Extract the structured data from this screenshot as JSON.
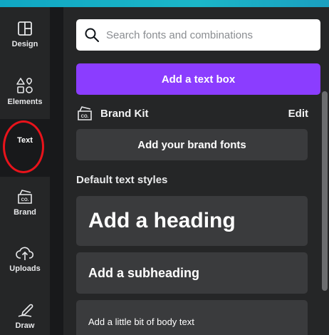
{
  "rail": {
    "items": [
      {
        "label": "Design",
        "icon": "design-icon"
      },
      {
        "label": "Elements",
        "icon": "elements-icon"
      },
      {
        "label": "Text",
        "icon": "text-icon",
        "active": true
      },
      {
        "label": "Brand",
        "icon": "brand-icon"
      },
      {
        "label": "Uploads",
        "icon": "uploads-icon"
      },
      {
        "label": "Draw",
        "icon": "draw-icon"
      }
    ]
  },
  "search": {
    "placeholder": "Search fonts and combinations",
    "icon": "search-icon"
  },
  "add_text_box": "Add a text box",
  "brand_kit": {
    "label": "Brand Kit",
    "edit": "Edit",
    "icon": "brand-kit-icon"
  },
  "add_brand_fonts": "Add your brand fonts",
  "default_styles": {
    "title": "Default text styles",
    "heading": "Add a heading",
    "subheading": "Add a subheading",
    "body": "Add a little bit of body text"
  },
  "colors": {
    "accent": "#8b3dff",
    "highlight_circle": "#e8131b",
    "top_strip": "#10a7c4"
  }
}
